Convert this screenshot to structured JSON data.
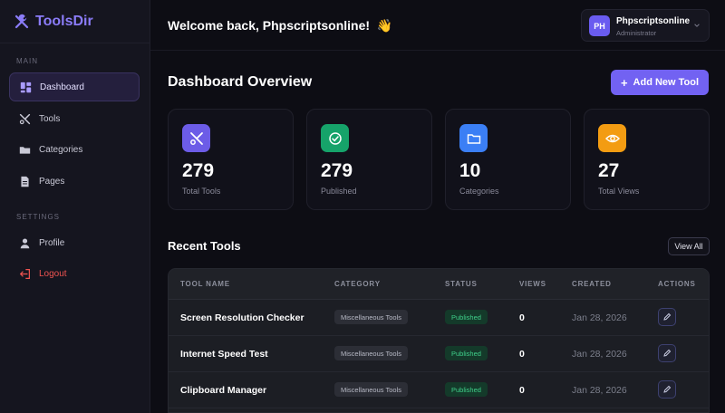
{
  "brand": {
    "name": "ToolsDir"
  },
  "sidebar": {
    "main_label": "MAIN",
    "settings_label": "SETTINGS",
    "items": [
      {
        "label": "Dashboard",
        "icon": "dashboard-icon",
        "active": true
      },
      {
        "label": "Tools",
        "icon": "tools-icon"
      },
      {
        "label": "Categories",
        "icon": "folder-icon"
      },
      {
        "label": "Pages",
        "icon": "file-icon"
      }
    ],
    "settings_items": [
      {
        "label": "Profile",
        "icon": "user-icon"
      },
      {
        "label": "Logout",
        "icon": "logout-icon"
      }
    ]
  },
  "header": {
    "welcome": "Welcome back, Phpscriptsonline!",
    "welcome_emoji": "👋",
    "user": {
      "initials": "PH",
      "name": "Phpscriptsonline",
      "role": "Administrator"
    }
  },
  "overview": {
    "title": "Dashboard Overview",
    "add_button": "Add New Tool",
    "stats": [
      {
        "value": "279",
        "label": "Total Tools",
        "icon": "tools-icon",
        "color": "#6c5ce7"
      },
      {
        "value": "279",
        "label": "Published",
        "icon": "check-circle-icon",
        "color": "#16a36a"
      },
      {
        "value": "10",
        "label": "Categories",
        "icon": "folder-icon",
        "color": "#3b7ff5"
      },
      {
        "value": "27",
        "label": "Total Views",
        "icon": "eye-icon",
        "color": "#f39c12"
      }
    ]
  },
  "recent": {
    "title": "Recent Tools",
    "view_all": "View All",
    "columns": [
      "TOOL NAME",
      "CATEGORY",
      "STATUS",
      "VIEWS",
      "CREATED",
      "ACTIONS"
    ],
    "rows": [
      {
        "name": "Screen Resolution Checker",
        "category": "Miscellaneous Tools",
        "status": "Published",
        "views": "0",
        "created": "Jan 28, 2026"
      },
      {
        "name": "Internet Speed Test",
        "category": "Miscellaneous Tools",
        "status": "Published",
        "views": "0",
        "created": "Jan 28, 2026"
      },
      {
        "name": "Clipboard Manager",
        "category": "Miscellaneous Tools",
        "status": "Published",
        "views": "0",
        "created": "Jan 28, 2026"
      }
    ]
  },
  "colors": {
    "accent": "#7262f2",
    "sidebar_bg": "#15151f",
    "page_bg": "#0d0d14",
    "danger": "#ef5350",
    "success": "#3fd08a"
  }
}
